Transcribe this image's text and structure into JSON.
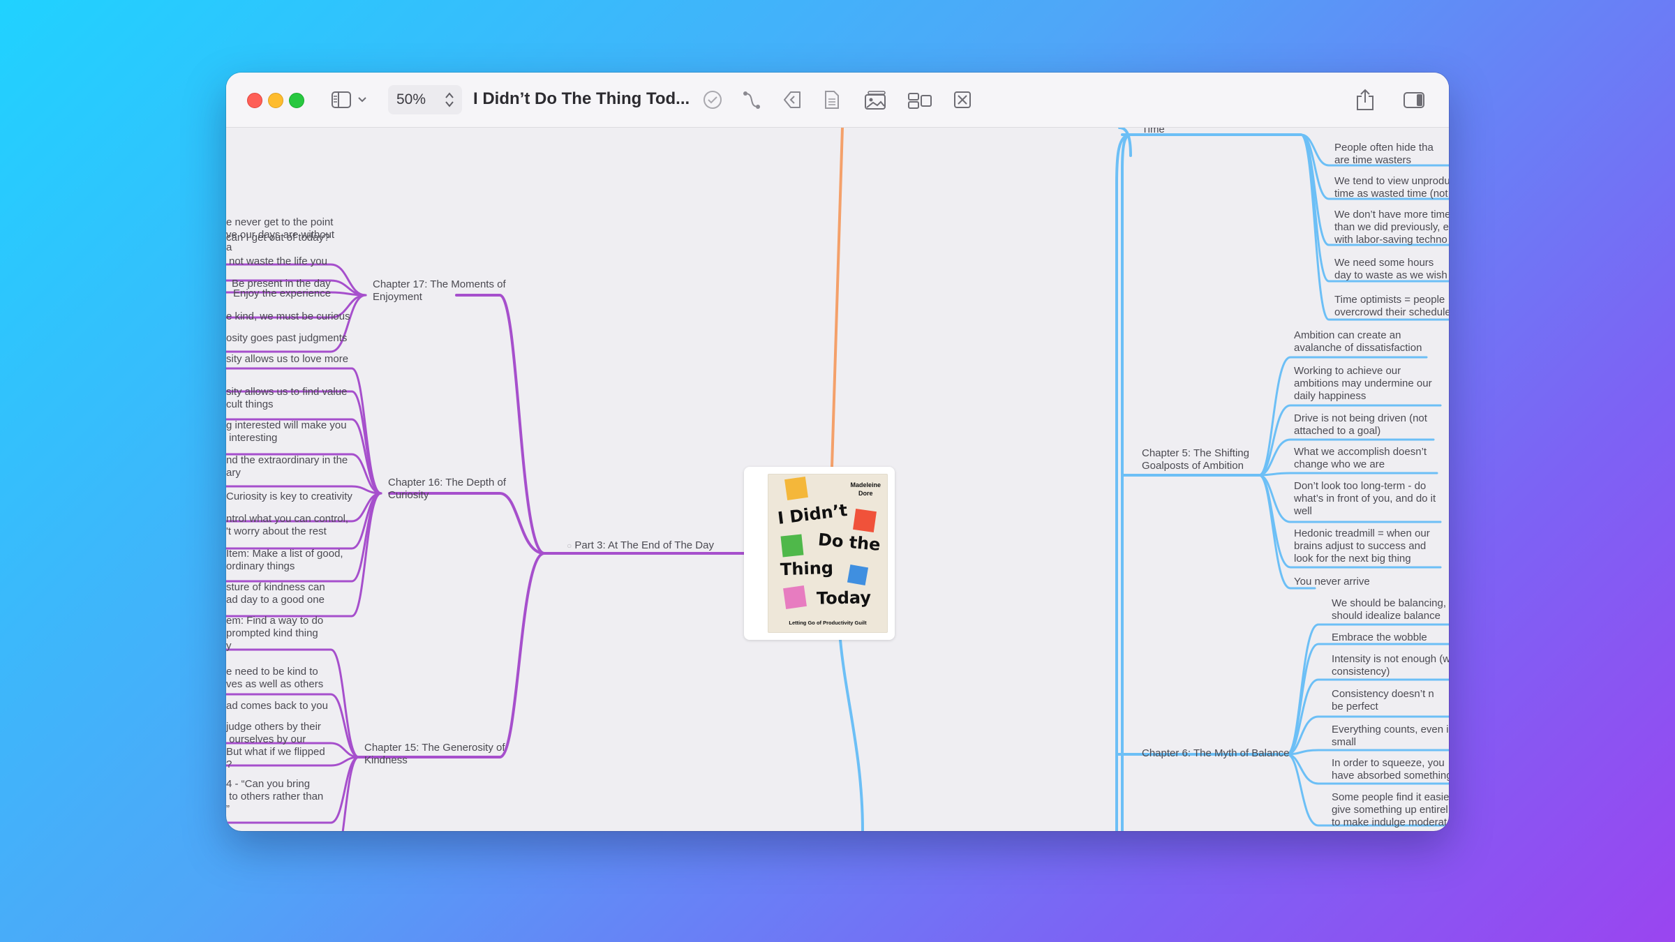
{
  "window": {
    "zoom_value": "50%",
    "doc_title": "I Didn’t Do The Thing Tod..."
  },
  "toolbar_icons": [
    "sidebar-icon",
    "chevron-down-icon",
    "checkmark-icon",
    "connection-icon",
    "back-link-icon",
    "document-icon",
    "photo-icon",
    "layout-icon",
    "fit-icon",
    "share-icon",
    "inspector-icon"
  ],
  "colors": {
    "purple": "#a64fcc",
    "blue": "#6cbff6",
    "orange": "#f4a06a"
  },
  "root": {
    "author": "Madeleine\nDore",
    "title_lines": [
      "I Didn’t",
      "Do the",
      "Thing",
      "Today"
    ],
    "subtitle": "Letting Go of Productivity Guilt"
  },
  "left": {
    "part": "Part 3: At The End of The Day",
    "ch17": "Chapter 17: The Moments of\nEnjoyment",
    "ch17_items": [
      "e never get to the point\nve our days are without\na",
      "Be present in the day",
      "can I get out of today?",
      "not waste the life you",
      "Enjoy the experience"
    ],
    "ch16": "Chapter 16: The Depth of\nCuriosity",
    "ch16_items": [
      "e kind, we must be curious",
      "osity goes past judgments",
      "sity allows us to love more",
      "sity allows us to find value\ncult things",
      "g interested will make you\n interesting",
      "nd the extraordinary in the\nary",
      "Curiosity is key to creativity",
      "ntrol what you can control,\n't worry about the rest",
      "Item: Make a list of good,\nordinary things"
    ],
    "ch15": "Chapter 15: The Generosity of\nKindness",
    "ch15_items": [
      "sture of kindness can\nad day to a good one",
      "em: Find a way to do\nprompted kind thing\ny",
      "e need to be kind to\nves as well as others",
      "ad comes back to you",
      "judge others by their\n ourselves by our\nBut what if we flipped\n?",
      "4 - “Can you bring\n to others rather than\n”"
    ]
  },
  "right": {
    "ch_top_cut": "Time",
    "top_items": [
      "People often hide tha\nare time wasters",
      "We tend to view unprodu\ntime as wasted time (not",
      "We don’t have more time\nthan we did previously, e\nwith labor-saving techno",
      "We need some hours\nday to waste as we wish",
      "Time optimists = people\novercrowd their schedule"
    ],
    "ch5": "Chapter 5: The Shifting\nGoalposts of Ambition",
    "ch5_items": [
      "Ambition can create an\navalanche of dissatisfaction",
      "Working to achieve our\nambitions may undermine our\ndaily happiness",
      "Drive is not being driven (not\nattached to a goal)",
      "What we accomplish doesn’t\nchange who we are",
      "Don’t look too long-term - do\nwhat’s in front of you, and do it\nwell",
      "Hedonic treadmill = when our\nbrains adjust to success and\nlook for the next big thing",
      "You never arrive"
    ],
    "ch6": "Chapter 6: The Myth of Balance",
    "ch6_items": [
      "We should be balancing,\nshould idealize balance",
      "Embrace the wobble",
      "Intensity is not enough (w\nconsistency)",
      "Consistency doesn’t n\nbe perfect",
      "Everything counts, even i\nsmall",
      "In order to squeeze, you\nhave absorbed something",
      "Some people find it easie\ngive something up entirel\nto make indulge moderat"
    ]
  }
}
